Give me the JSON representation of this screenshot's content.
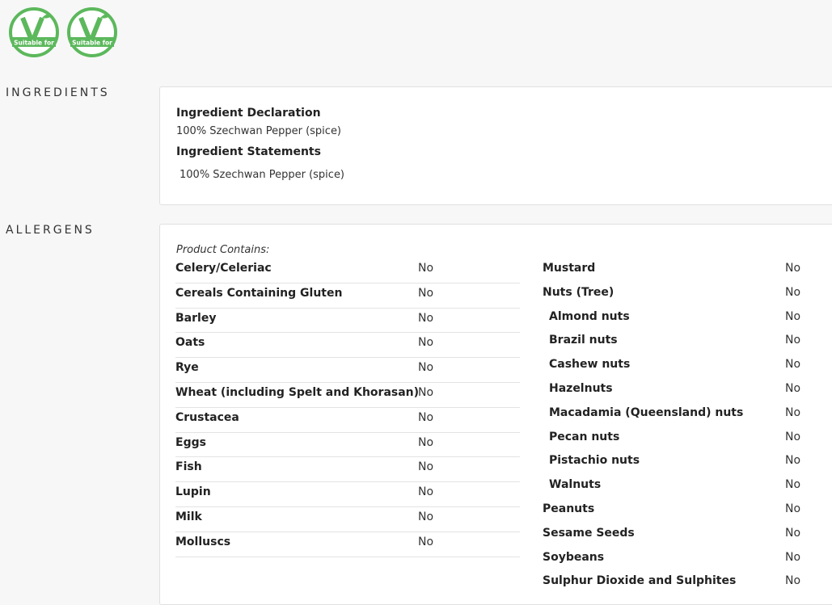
{
  "badges": [
    {
      "text": "Suitable for",
      "icon": "vegetarian-v-icon",
      "color": "#5cb85c"
    },
    {
      "text": "Suitable for",
      "icon": "vegan-v-icon",
      "color": "#5cb85c"
    }
  ],
  "ingredients": {
    "section_label": "INGREDIENTS",
    "declaration_heading": "Ingredient Declaration",
    "declaration_text": "100% Szechwan Pepper (spice)",
    "statements_heading": "Ingredient Statements",
    "statements_text": "100% Szechwan Pepper (spice)"
  },
  "allergens": {
    "section_label": "ALLERGENS",
    "contains_label": "Product Contains:",
    "left": [
      {
        "name": "Celery/Celeriac",
        "value": "No"
      },
      {
        "name": "Cereals Containing Gluten",
        "value": "No"
      },
      {
        "name": "Barley",
        "value": "No"
      },
      {
        "name": "Oats",
        "value": "No"
      },
      {
        "name": "Rye",
        "value": "No"
      },
      {
        "name": "Wheat (including Spelt and Khorasan)",
        "value": "No"
      },
      {
        "name": "Crustacea",
        "value": "No"
      },
      {
        "name": "Eggs",
        "value": "No"
      },
      {
        "name": "Fish",
        "value": "No"
      },
      {
        "name": "Lupin",
        "value": "No"
      },
      {
        "name": "Milk",
        "value": "No"
      },
      {
        "name": "Molluscs",
        "value": "No"
      }
    ],
    "right": [
      {
        "name": "Mustard",
        "value": "No"
      },
      {
        "name": "Nuts (Tree)",
        "value": "No"
      },
      {
        "name": "Almond nuts",
        "value": "No"
      },
      {
        "name": "Brazil nuts",
        "value": "No"
      },
      {
        "name": "Cashew nuts",
        "value": "No"
      },
      {
        "name": "Hazelnuts",
        "value": "No"
      },
      {
        "name": "Macadamia (Queensland) nuts",
        "value": "No"
      },
      {
        "name": "Pecan nuts",
        "value": "No"
      },
      {
        "name": "Pistachio nuts",
        "value": "No"
      },
      {
        "name": "Walnuts",
        "value": "No"
      },
      {
        "name": "Peanuts",
        "value": "No"
      },
      {
        "name": "Sesame Seeds",
        "value": "No"
      },
      {
        "name": "Soybeans",
        "value": "No"
      },
      {
        "name": "Sulphur Dioxide and Sulphites",
        "value": "No"
      }
    ]
  }
}
